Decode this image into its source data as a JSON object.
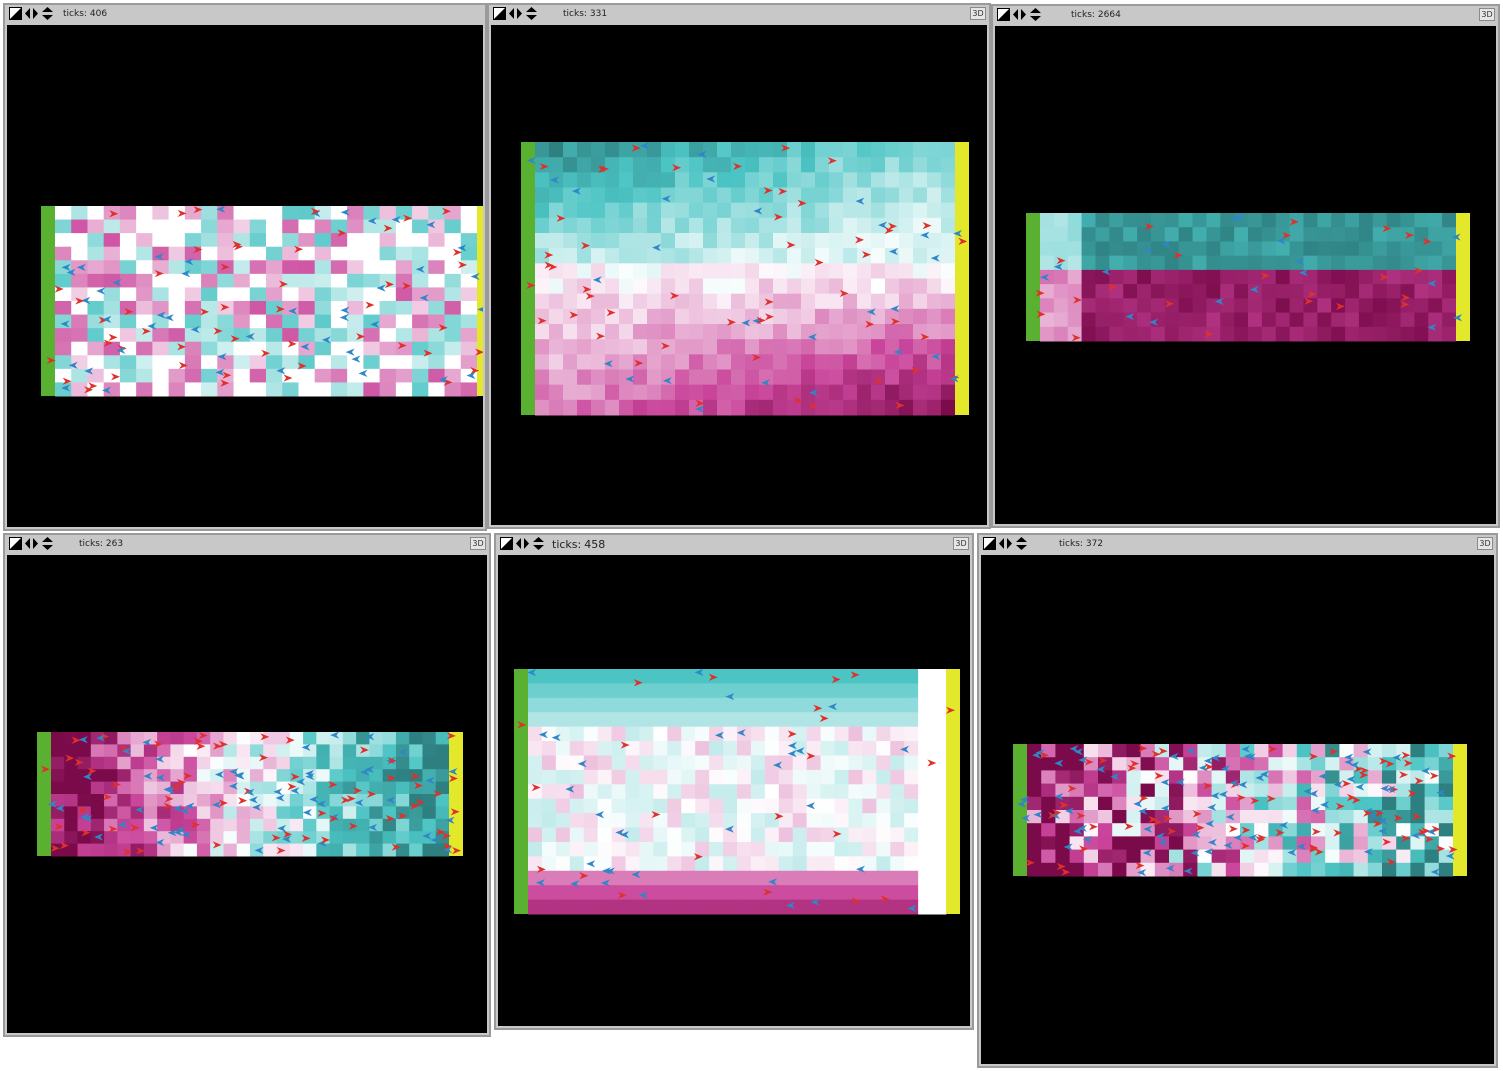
{
  "colors": {
    "source_bar": "#5ab030",
    "sink_bar": "#e4e82a",
    "agent_red": "#e1302a",
    "agent_blue": "#2f86c8",
    "world_bg": "#000000"
  },
  "icons": [
    "edit-icon",
    "horizontal-arrows-icon",
    "vertical-arrows-icon"
  ],
  "views": [
    {
      "ticks_label": "ticks:",
      "ticks_value": "406",
      "has_3d_button": false,
      "button_3d_label": "3D",
      "pattern": "scatter",
      "red_share": 0.5,
      "agent_density": 0.55
    },
    {
      "ticks_label": "ticks:",
      "ticks_value": "331",
      "has_3d_button": true,
      "button_3d_label": "3D",
      "pattern": "lanes-top-teal",
      "red_share": 0.5,
      "agent_density": 0.3
    },
    {
      "ticks_label": "ticks:",
      "ticks_value": "2664",
      "has_3d_button": true,
      "button_3d_label": "3D",
      "pattern": "split-teal-top",
      "red_share": 0.5,
      "agent_density": 0.3
    },
    {
      "ticks_label": "ticks:",
      "ticks_value": "263",
      "has_3d_button": true,
      "button_3d_label": "3D",
      "pattern": "gradient-magenta-left",
      "red_share": 0.55,
      "agent_density": 0.9
    },
    {
      "ticks_label": "ticks:",
      "ticks_value": "458",
      "has_3d_button": true,
      "button_3d_label": "3D",
      "pattern": "lanes-sparse",
      "red_share": 0.5,
      "agent_density": 0.22
    },
    {
      "ticks_label": "ticks:",
      "ticks_value": "372",
      "has_3d_button": true,
      "button_3d_label": "3D",
      "pattern": "dense-mixed",
      "red_share": 0.5,
      "agent_density": 1.1
    }
  ]
}
